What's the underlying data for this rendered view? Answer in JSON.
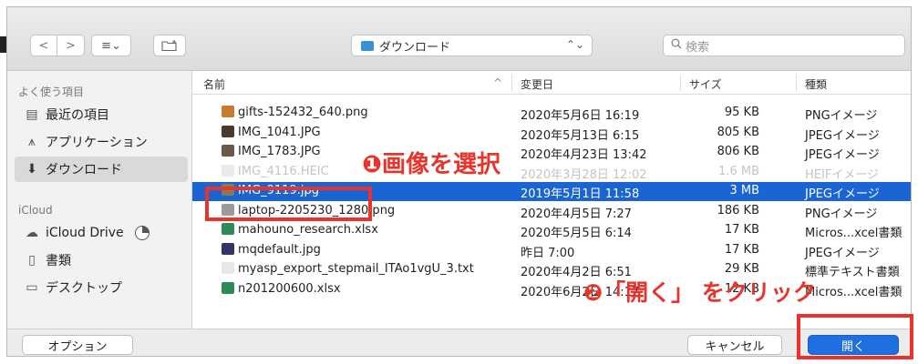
{
  "toolbar": {
    "nav_back": "<",
    "nav_forward": ">",
    "view_label": "≡⌄",
    "location": "ダウンロード",
    "location_arrows": "⌃⌄",
    "search_placeholder": "検索"
  },
  "sidebar": {
    "favorites_header": "よく使う項目",
    "favorites": [
      {
        "label": "最近の項目",
        "icon": "recent-icon"
      },
      {
        "label": "アプリケーション",
        "icon": "applications-icon"
      },
      {
        "label": "ダウンロード",
        "icon": "download-icon",
        "selected": true
      }
    ],
    "icloud_header": "iCloud",
    "icloud": [
      {
        "label": "iCloud Drive",
        "icon": "cloud-icon"
      },
      {
        "label": "書類",
        "icon": "document-icon"
      },
      {
        "label": "デスクトップ",
        "icon": "desktop-icon"
      }
    ]
  },
  "columns": {
    "name": "名前",
    "sort": "^",
    "date": "変更日",
    "size": "サイズ",
    "kind": "種類"
  },
  "files": [
    {
      "name": "gifts-152432_640.png",
      "date": "2020年5月6日 16:19",
      "size": "95 KB",
      "kind": "PNGイメージ",
      "color": "#c97b2b"
    },
    {
      "name": "IMG_1041.JPG",
      "date": "2020年5月13日 6:15",
      "size": "805 KB",
      "kind": "JPEGイメージ",
      "color": "#4a3a2e"
    },
    {
      "name": "IMG_1783.JPG",
      "date": "2020年4月23日 13:42",
      "size": "806 KB",
      "kind": "JPEGイメージ",
      "color": "#6b5a4a"
    },
    {
      "name": "IMG_4116.HEIC",
      "date": "2020年3月28日 12:02",
      "size": "1.6 MB",
      "kind": "HEIFイメージ",
      "color": "#d5d5d5",
      "dim": true
    },
    {
      "name": "IMG_9119.jpg",
      "date": "2019年5月1日 11:58",
      "size": "3 MB",
      "kind": "JPEGイメージ",
      "color": "#8a7a52",
      "selected": true
    },
    {
      "name": "laptop-2205230_1280.png",
      "date": "2020年4月5日 7:27",
      "size": "186 KB",
      "kind": "PNGイメージ",
      "color": "#9a9a9a"
    },
    {
      "name": "mahouno_research.xlsx",
      "date": "2020年5月5日 6:14",
      "size": "17 KB",
      "kind": "Micros...xcel書類",
      "color": "#2e8b57"
    },
    {
      "name": "mqdefault.jpg",
      "date": "昨日 7:00",
      "size": "17 KB",
      "kind": "JPEGイメージ",
      "color": "#333366"
    },
    {
      "name": "myasp_export_stepmail_ITAo1vgU_3.txt",
      "date": "2020年4月2日 6:51",
      "size": "29 KB",
      "kind": "標準テキスト書類",
      "color": "#e8e8e8"
    },
    {
      "name": "n201200600.xlsx",
      "date": "2020年6月2日 14:17",
      "size": "12 KB",
      "kind": "Micros...xcel書類",
      "color": "#2e8b57"
    }
  ],
  "footer": {
    "options_label": "オプション",
    "cancel_label": "キャンセル",
    "open_label": "開く"
  },
  "annotations": {
    "step1": "❶画像を選択",
    "step2": "❷「開く」 をクリック",
    "color": "#e8342a"
  }
}
